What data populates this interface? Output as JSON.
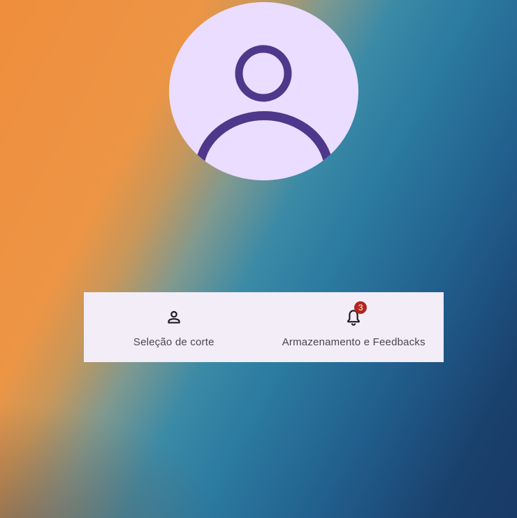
{
  "profile": {
    "avatar_icon": "person-icon"
  },
  "nav": {
    "items": [
      {
        "label": "Seleção de corte",
        "icon": "person-outline-icon"
      },
      {
        "label": "Armazenamento e Feedbacks",
        "icon": "bell-outline-icon",
        "badge": "3"
      }
    ]
  },
  "colors": {
    "avatar_bg": "#eaddff",
    "avatar_icon": "#4f378b",
    "nav_bg": "#f3edf7",
    "nav_text": "#49454f",
    "badge_bg": "#b3261e"
  }
}
